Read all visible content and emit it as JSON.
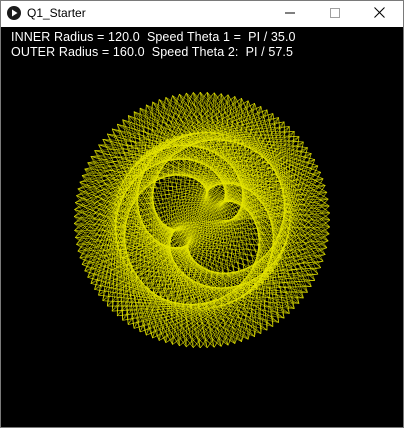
{
  "window": {
    "title": "Q1_Starter",
    "icon": "processing-play-icon",
    "buttons": {
      "minimize_icon": "minimize-icon",
      "maximize_icon": "maximize-icon",
      "close_icon": "close-icon"
    }
  },
  "canvas": {
    "background": "#000000",
    "line_color": "#e6e600",
    "text_color": "#ffffff",
    "info_line_1": "INNER Radius = 120.0  Speed Theta 1 =  PI / 35.0",
    "info_line_2": "OUTER Radius = 160.0  Speed Theta 2:  PI / 57.5"
  },
  "pattern": {
    "inner_radius": 120.0,
    "outer_radius": 160.0,
    "speed_theta_1_divisor": 35.0,
    "speed_theta_2_divisor": 57.5
  }
}
